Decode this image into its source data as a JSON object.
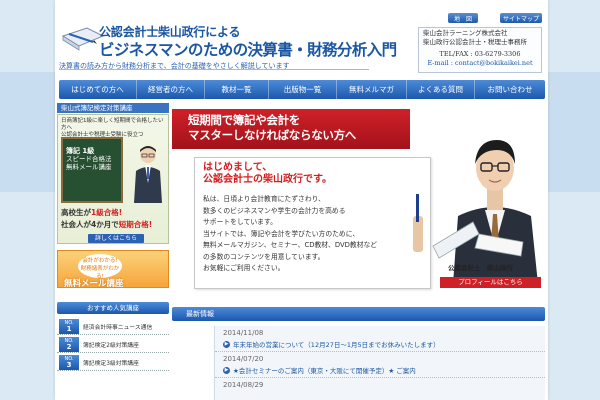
{
  "header": {
    "logo_line1": "公認会計士柴山政行による",
    "logo_line2": "ビジネスマンのための決算書・財務分析入門",
    "tagline": "決算書の読み方から財務分析まで、会計の基礎をやさしく解説しています",
    "map_btn": "地　図",
    "sitemap_btn": "サイトマップ",
    "company_name": "柴山会計ラーニング株式会社",
    "company_office": "柴山政行公認会計士・税理士事務所",
    "tel": "TEL/FAX : 03-6279-3306",
    "email": "E-mail : contact@bokikaikei.net"
  },
  "nav": [
    "はじめての方へ",
    "経営者の方へ",
    "教材一覧",
    "出版物一覧",
    "無料メルマガ",
    "よくある質問",
    "お問い合わせ"
  ],
  "sidebar": {
    "course_header": "柴山式簿記検定対策講座",
    "promo_top": "日商簿記1級に楽しく短期間で合格したい方へ",
    "promo_top2": "公認会計士や税理士受験に役立つ",
    "chalk_line1": "簿記 1級",
    "chalk_line2": "スピード合格法",
    "chalk_line3": "無料メール講座",
    "highschool_prefix": "高校生が",
    "highschool_em": "1級合格!",
    "worker_prefix": "社会人が4か月で",
    "worker_em": "短期合格!",
    "detail_btn": "詳しくはこちら",
    "banner_line1": "会計がわかる!",
    "banner_line2": "財務諸表がわかる!",
    "banner_line3": "無料メール講座",
    "popular_header": "おすすめ人気講座",
    "ranks": [
      {
        "no_label": "NO.",
        "no": "1",
        "title": "経済会計時事ニュース通信"
      },
      {
        "no_label": "NO.",
        "no": "2",
        "title": "簿記検定2級対策講座"
      },
      {
        "no_label": "NO.",
        "no": "3",
        "title": "簿記検定3級対策講座"
      }
    ]
  },
  "hero": {
    "headline1": "短期間で簿記や会計を",
    "headline2": "マスターしなければならない方へ",
    "greeting1": "はじめまして、",
    "greeting2": "公認会計士の柴山政行です。",
    "body": [
      "私は、日頃より会計教育にたずさわり、",
      "数多くのビジネスマンや学生の会計力を高める",
      "サポートをしています。",
      "当サイトでは、簿記や会計を学びたい方のために、",
      "無料メールマガジン、セミナー、CD教材、DVD教材など",
      "の多数のコンテンツを用意しています。",
      "お気軽にご利用ください。"
    ],
    "caption": "公認会計士　柴山政行",
    "profile_btn": "プロフィールはこちら"
  },
  "news": {
    "header": "最新情報",
    "items": [
      {
        "date": "2014/11/08",
        "title": "年末年始の営業について（12月27日～1月5日までお休みいたします）"
      },
      {
        "date": "2014/07/20",
        "title": "★会計セミナーのご案内（東京・大阪にて開催予定）★ ご案内"
      },
      {
        "date": "2014/08/29",
        "title": ""
      }
    ]
  }
}
